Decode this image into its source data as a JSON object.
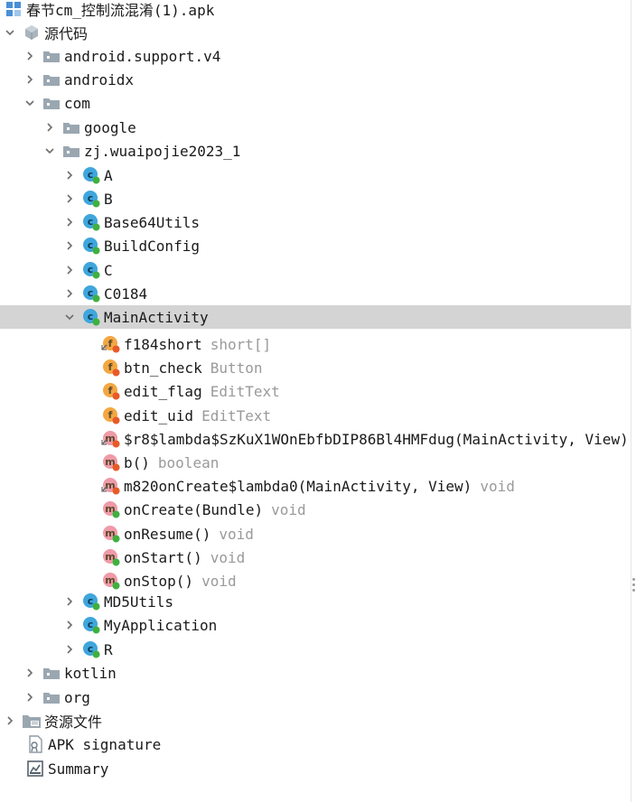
{
  "colors": {
    "selection": "#d4d4d4",
    "folder": "#9aa7b1",
    "class_icon": "#3fa6dc",
    "field_icon": "#f4a742",
    "method_icon": "#ef9aa8",
    "public_dot": "#3fb03f",
    "private_dot": "#e85a28",
    "type_text": "#9a9a9a"
  },
  "tree": {
    "root": {
      "label": "春节cm_控制流混淆(1).apk",
      "icon": "apk-icon"
    },
    "source": {
      "label": "源代码",
      "icon": "package-icon"
    },
    "pkg_android_support": {
      "label": "android.support.v4",
      "icon": "folder-icon"
    },
    "pkg_androidx": {
      "label": "androidx",
      "icon": "folder-icon"
    },
    "pkg_com": {
      "label": "com",
      "icon": "folder-icon"
    },
    "pkg_google": {
      "label": "google",
      "icon": "folder-icon"
    },
    "pkg_wuaipojie": {
      "label": "zj.wuaipojie2023_1",
      "icon": "folder-icon"
    },
    "classes": [
      {
        "label": "A"
      },
      {
        "label": "B"
      },
      {
        "label": "Base64Utils"
      },
      {
        "label": "BuildConfig"
      },
      {
        "label": "C"
      },
      {
        "label": "C0184"
      },
      {
        "label": "MainActivity",
        "selected": true
      },
      {
        "label": "MD5Utils"
      },
      {
        "label": "MyApplication"
      },
      {
        "label": "R"
      }
    ],
    "members": [
      {
        "name": "f184short",
        "type": "short[]",
        "kind": "field",
        "access": "private",
        "synthetic": true
      },
      {
        "name": "btn_check",
        "type": "Button",
        "kind": "field",
        "access": "private"
      },
      {
        "name": "edit_flag",
        "type": "EditText",
        "kind": "field",
        "access": "private"
      },
      {
        "name": "edit_uid",
        "type": "EditText",
        "kind": "field",
        "access": "private"
      },
      {
        "name": "$r8$lambda$SzKuX1WOnEbfbDIP86Bl4HMFdug(MainActivity, View)",
        "type": "",
        "kind": "method",
        "access": "private",
        "synthetic": true
      },
      {
        "name": "b()",
        "type": "boolean",
        "kind": "method",
        "access": "private"
      },
      {
        "name": "m820onCreate$lambda0(MainActivity, View)",
        "type": "void",
        "kind": "method",
        "access": "private",
        "synthetic": true
      },
      {
        "name": "onCreate(Bundle)",
        "type": "void",
        "kind": "method",
        "access": "public"
      },
      {
        "name": "onResume()",
        "type": "void",
        "kind": "method",
        "access": "public"
      },
      {
        "name": "onStart()",
        "type": "void",
        "kind": "method",
        "access": "public"
      },
      {
        "name": "onStop()",
        "type": "void",
        "kind": "method",
        "access": "public"
      }
    ],
    "pkg_kotlin": {
      "label": "kotlin",
      "icon": "folder-icon"
    },
    "pkg_org": {
      "label": "org",
      "icon": "folder-icon"
    },
    "resources": {
      "label": "资源文件",
      "icon": "resources-folder-icon"
    },
    "apk_signature": {
      "label": "APK signature",
      "icon": "certificate-icon"
    },
    "summary": {
      "label": "Summary",
      "icon": "summary-icon"
    }
  }
}
